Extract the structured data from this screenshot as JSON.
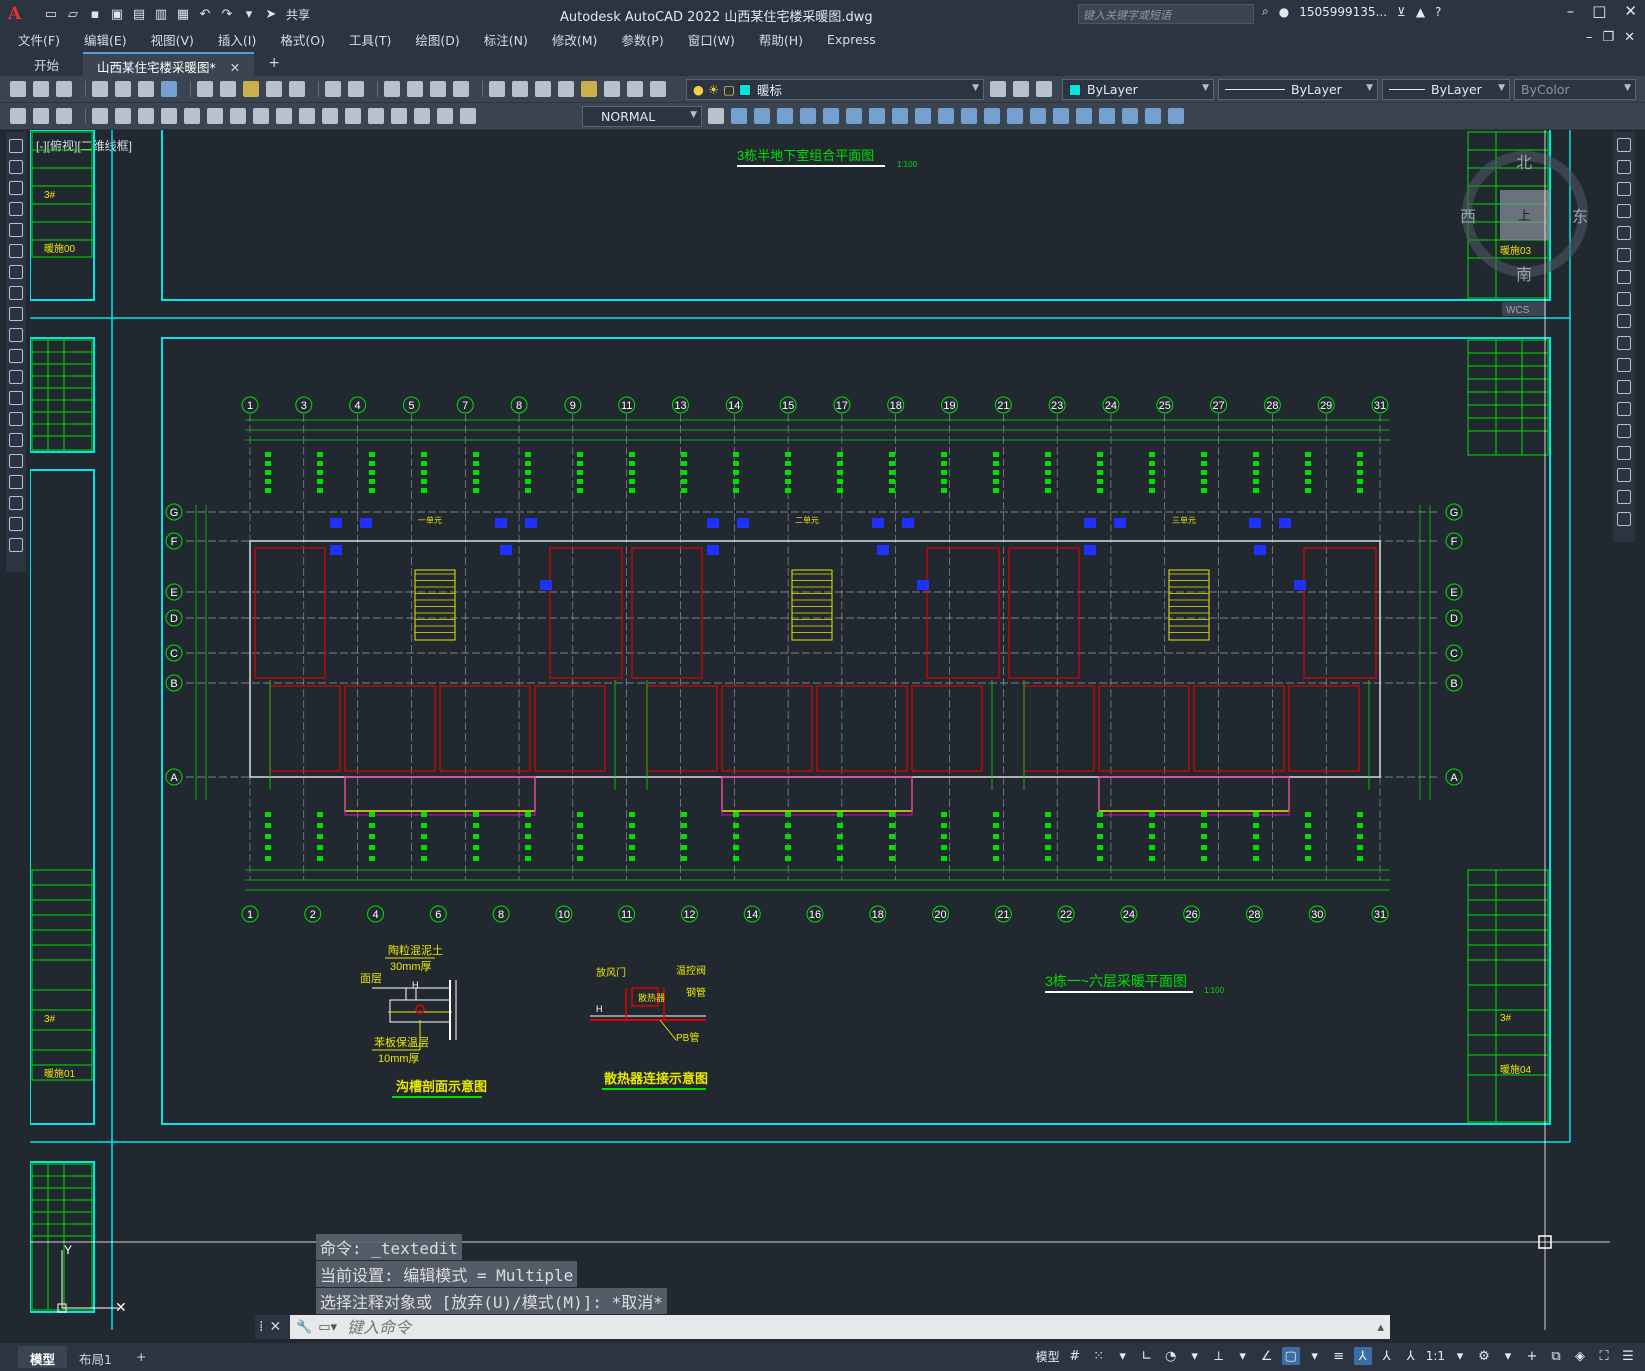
{
  "title_bar": {
    "app_logo": "A",
    "share_label": "共享",
    "title": "Autodesk AutoCAD 2022    山西某住宅楼采暖图.dwg",
    "search_placeholder": "键入关键字或短语",
    "user": "1505999135...",
    "help": "?"
  },
  "menu": [
    "文件(F)",
    "编辑(E)",
    "视图(V)",
    "插入(I)",
    "格式(O)",
    "工具(T)",
    "绘图(D)",
    "标注(N)",
    "修改(M)",
    "参数(P)",
    "窗口(W)",
    "帮助(H)",
    "Express"
  ],
  "tabs": {
    "start": "开始",
    "active": "山西某住宅楼采暖图*",
    "close": "✕",
    "add": "+"
  },
  "toolbar": {
    "layer": "暖标",
    "color": "ByLayer",
    "linetype": "ByLayer",
    "lineweight": "ByLayer",
    "plotstyle": "ByColor",
    "textstyle": "NORMAL"
  },
  "viewport_label": "[-][俯视][二维线框]",
  "drawing": {
    "title1": "3栋半地下室组合平面图",
    "title2": "3栋一~六层采暖平面图",
    "scale": "1:100",
    "detail1_title": "沟槽剖面示意图",
    "detail2_title": "散热器连接示意图",
    "detail1_labels": [
      "陶粒混泥土",
      "30mm厚",
      "面层",
      "苯板保温层",
      "10mm厚"
    ],
    "detail2_labels": [
      "放风门",
      "温控阀",
      "散热器",
      "钢管",
      "PB管"
    ],
    "axis_top": [
      "1",
      "3",
      "4",
      "5",
      "7",
      "8",
      "9",
      "11",
      "13",
      "14",
      "15",
      "17",
      "18",
      "19",
      "21",
      "23",
      "24",
      "25",
      "27",
      "28",
      "29",
      "31"
    ],
    "axis_bottom": [
      "1",
      "2",
      "4",
      "6",
      "8",
      "10",
      "11",
      "12",
      "14",
      "16",
      "18",
      "20",
      "21",
      "22",
      "24",
      "26",
      "28",
      "30",
      "31"
    ],
    "axis_rows": [
      "G",
      "F",
      "E",
      "D",
      "C",
      "B",
      "A"
    ],
    "units": [
      "一单元",
      "二单元",
      "三单元"
    ]
  },
  "viewcube": {
    "north": "北",
    "south": "南",
    "east": "东",
    "west": "西",
    "top": "上",
    "wcs": "WCS"
  },
  "title_block": {
    "row1": "3#",
    "row2": "暖施00",
    "row3": "暖施01",
    "row4": "暖施03",
    "row5": "暖施04"
  },
  "command_history": [
    "命令: _textedit",
    "当前设置: 编辑模式 = Multiple",
    "选择注释对象或 [放弃(U)/模式(M)]: *取消*"
  ],
  "command_placeholder": "键入命令",
  "layout_tabs": [
    "模型",
    "布局1"
  ],
  "layout_add": "+",
  "status": {
    "model": "模型",
    "scale": "1:1"
  },
  "colors": {
    "accent": "#5b9bd5",
    "cad_green": "#00e000",
    "cad_cyan": "#00e5e5",
    "cad_red": "#e00000",
    "cad_yellow": "#e8e800",
    "cad_magenta": "#e000e0",
    "cad_blue": "#2030ff"
  }
}
